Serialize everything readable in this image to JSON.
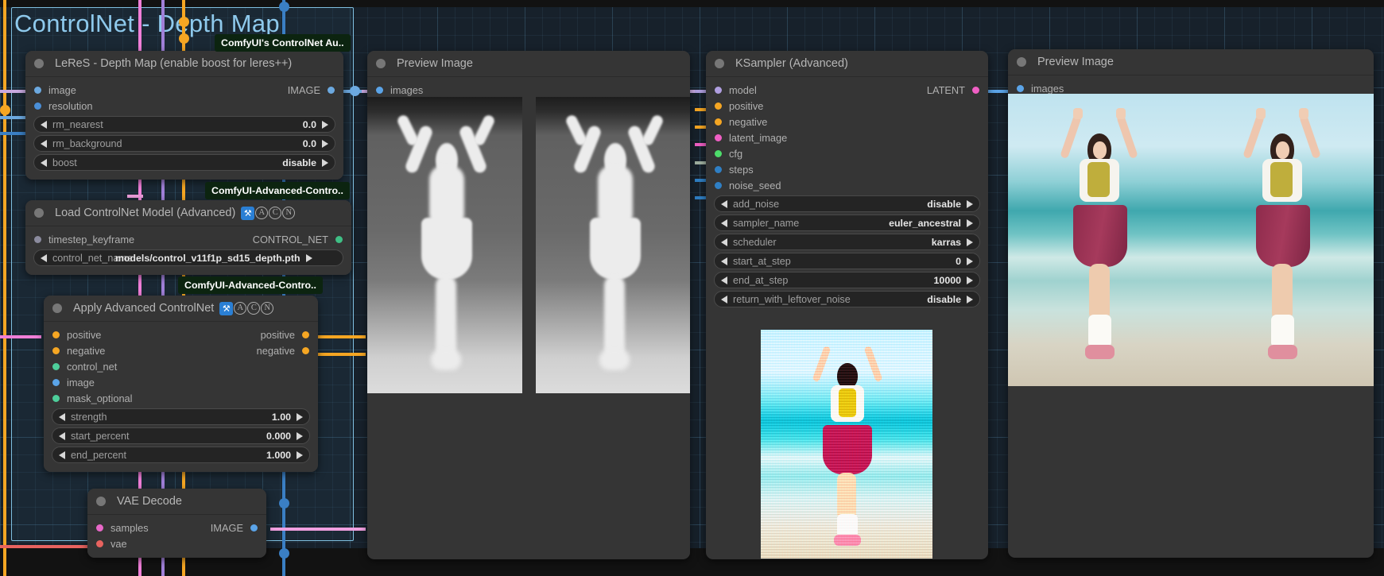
{
  "canvas": {
    "group_title": "ControlNet - Depth Map",
    "group_color": "#7fbfe0",
    "background_color": "#17212b",
    "grid_color": "#5a8caa"
  },
  "tooltips": [
    {
      "name": "tooltip-controlnet-aux",
      "text": "ComfyUI's ControlNet Au.."
    },
    {
      "name": "tooltip-advanced-controlnet-1",
      "text": "ComfyUI-Advanced-Contro.."
    },
    {
      "name": "tooltip-advanced-controlnet-2",
      "text": "ComfyUI-Advanced-Contro.."
    }
  ],
  "nodes": {
    "leres": {
      "title": "LeReS - Depth Map (enable boost for leres++)",
      "inputs": [
        {
          "label": "image",
          "color": "#6ca9e0"
        },
        {
          "label": "resolution",
          "color": "#4a8fd8"
        }
      ],
      "outputs": [
        {
          "label": "IMAGE",
          "color": "#6ca9e0"
        }
      ],
      "widgets": [
        {
          "name": "rm_nearest",
          "value": "0.0"
        },
        {
          "name": "rm_background",
          "value": "0.0"
        },
        {
          "name": "boost",
          "value": "disable"
        }
      ]
    },
    "loadcontrolnet": {
      "title": "Load ControlNet Model (Advanced)",
      "badges": [
        "⚙",
        "A",
        "C",
        "N"
      ],
      "inputs": [
        {
          "label": "timestep_keyframe",
          "color": "#8b8b9e"
        }
      ],
      "outputs": [
        {
          "label": "CONTROL_NET",
          "color": "#3fbf85"
        }
      ],
      "widgets": [
        {
          "name": "control_net_name",
          "value": "models/control_v11f1p_sd15_depth.pth"
        }
      ]
    },
    "applycontrolnet": {
      "title": "Apply Advanced ControlNet",
      "badges": [
        "⚙",
        "A",
        "C",
        "N"
      ],
      "inputs": [
        {
          "label": "positive",
          "color": "#f5a623"
        },
        {
          "label": "negative",
          "color": "#f5a623"
        },
        {
          "label": "control_net",
          "color": "#4ecf9b"
        },
        {
          "label": "image",
          "color": "#5ba4e8"
        },
        {
          "label": "mask_optional",
          "color": "#4ecf9b"
        }
      ],
      "outputs": [
        {
          "label": "positive",
          "color": "#f5a623"
        },
        {
          "label": "negative",
          "color": "#f5a623"
        }
      ],
      "widgets": [
        {
          "name": "strength",
          "value": "1.00"
        },
        {
          "name": "start_percent",
          "value": "0.000"
        },
        {
          "name": "end_percent",
          "value": "1.000"
        }
      ]
    },
    "vaedecode": {
      "title": "VAE Decode",
      "inputs": [
        {
          "label": "samples",
          "color": "#e868c8"
        },
        {
          "label": "vae",
          "color": "#e8635f"
        }
      ],
      "outputs": [
        {
          "label": "IMAGE",
          "color": "#5ba4e8"
        }
      ]
    },
    "preview_depth": {
      "title": "Preview Image",
      "inputs": [
        {
          "label": "images",
          "color": "#5ba4e8"
        }
      ]
    },
    "preview_result": {
      "title": "Preview Image",
      "inputs": [
        {
          "label": "images",
          "color": "#5ba4e8"
        }
      ]
    },
    "ksampler": {
      "title": "KSampler (Advanced)",
      "inputs": [
        {
          "label": "model",
          "color": "#b09fe0"
        },
        {
          "label": "positive",
          "color": "#f5a623"
        },
        {
          "label": "negative",
          "color": "#f5a623"
        },
        {
          "label": "latent_image",
          "color": "#f05fc4"
        },
        {
          "label": "cfg",
          "color": "#4ddc6a"
        },
        {
          "label": "steps",
          "color": "#2f7fc4"
        },
        {
          "label": "noise_seed",
          "color": "#2f7fc4"
        }
      ],
      "outputs": [
        {
          "label": "LATENT",
          "color": "#f05fc4"
        }
      ],
      "widgets": [
        {
          "name": "add_noise",
          "value": "disable"
        },
        {
          "name": "sampler_name",
          "value": "euler_ancestral"
        },
        {
          "name": "scheduler",
          "value": "karras"
        },
        {
          "name": "start_at_step",
          "value": "0"
        },
        {
          "name": "end_at_step",
          "value": "10000"
        },
        {
          "name": "return_with_leftover_noise",
          "value": "disable"
        }
      ]
    }
  }
}
